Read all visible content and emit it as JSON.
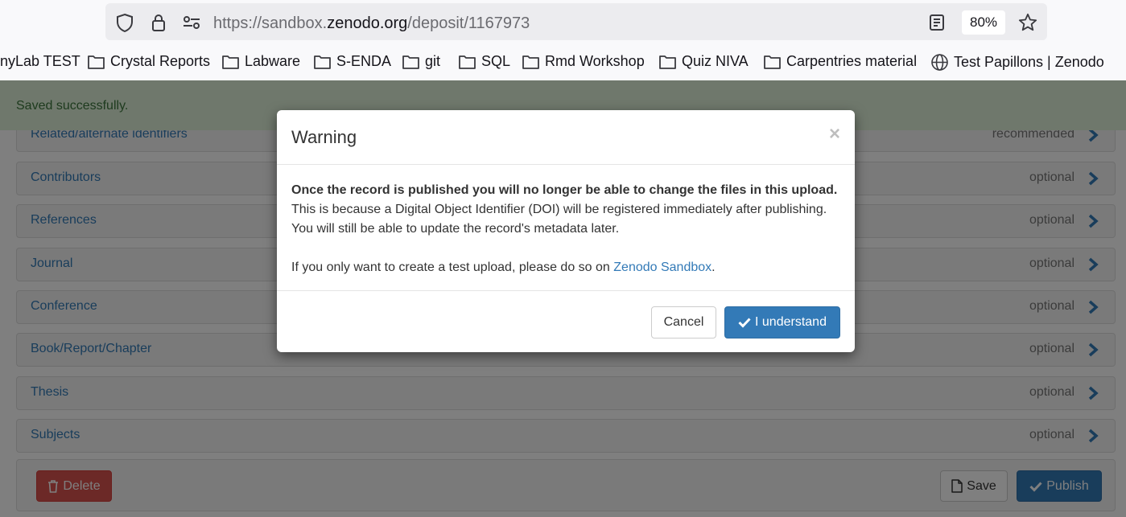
{
  "browser": {
    "url_prefix": "https://sandbox.",
    "url_host": "zenodo.org",
    "url_path": "/deposit/1167973",
    "zoom": "80%",
    "bookmarks": [
      {
        "label": "nyLab TEST",
        "icon": "none"
      },
      {
        "label": "Crystal Reports",
        "icon": "folder-icon"
      },
      {
        "label": "Labware",
        "icon": "folder-icon"
      },
      {
        "label": "S-ENDA",
        "icon": "folder-icon"
      },
      {
        "label": "git",
        "icon": "folder-icon"
      },
      {
        "label": "SQL",
        "icon": "folder-icon"
      },
      {
        "label": "Rmd Workshop",
        "icon": "folder-icon"
      },
      {
        "label": "Quiz NIVA",
        "icon": "folder-icon"
      },
      {
        "label": "Carpentries material",
        "icon": "folder-icon"
      },
      {
        "label": "Test Papillons | Zenodo",
        "icon": "globe-icon"
      }
    ]
  },
  "alert": {
    "text": "Saved successfully."
  },
  "sections": [
    {
      "label": "Related/alternate identifiers",
      "tag": "recommended"
    },
    {
      "label": "Contributors",
      "tag": "optional"
    },
    {
      "label": "References",
      "tag": "optional"
    },
    {
      "label": "Journal",
      "tag": "optional"
    },
    {
      "label": "Conference",
      "tag": "optional"
    },
    {
      "label": "Book/Report/Chapter",
      "tag": "optional"
    },
    {
      "label": "Thesis",
      "tag": "optional"
    },
    {
      "label": "Subjects",
      "tag": "optional"
    }
  ],
  "actions": {
    "delete": "Delete",
    "save": "Save",
    "publish": "Publish"
  },
  "modal": {
    "title": "Warning",
    "close": "×",
    "bold_text": "Once the record is published you will no longer be able to change the files in this upload.",
    "body_text": "This is because a Digital Object Identifier (DOI) will be registered immediately after publishing. You will still be able to update the record's metadata later.",
    "sandbox_prefix": "If you only want to create a test upload, please do so on ",
    "sandbox_link": "Zenodo Sandbox",
    "sandbox_suffix": ".",
    "cancel": "Cancel",
    "confirm": "I understand"
  },
  "colors": {
    "primary": "#337ab7",
    "danger": "#d9534f",
    "success_bg": "#dff0d8",
    "success_text": "#3c763d"
  }
}
